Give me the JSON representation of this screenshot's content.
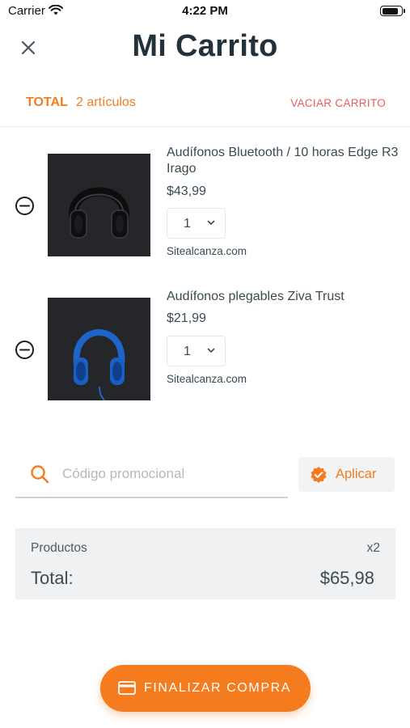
{
  "status_bar": {
    "carrier": "Carrier",
    "time": "4:22 PM",
    "battery_level": 0.9
  },
  "header": {
    "title": "Mi Carrito",
    "close_icon": "close-icon"
  },
  "summary": {
    "total_label": "TOTAL",
    "items_count": "2 artículos",
    "clear_label": "VACIAR CARRITO"
  },
  "items": [
    {
      "name": "Audífonos Bluetooth / 10 horas Edge R3 Irago",
      "price": "$43,99",
      "quantity": "1",
      "seller": "Sitealcanza.com",
      "image": "black-headphones"
    },
    {
      "name": "Audífonos plegables Ziva Trust",
      "price": "$21,99",
      "quantity": "1",
      "seller": "Sitealcanza.com",
      "image": "blue-headphones"
    }
  ],
  "promo": {
    "placeholder": "Código promocional",
    "value": "",
    "apply_label": "Aplicar"
  },
  "totals": {
    "products_label": "Productos",
    "products_count": "x2",
    "total_label": "Total:",
    "total_amount": "$65,98"
  },
  "checkout": {
    "label": "FINALIZAR COMPRA",
    "icon": "credit-card-icon"
  },
  "colors": {
    "accent": "#f47c1f",
    "danger": "#f05a5a",
    "text": "#33414a",
    "panel": "#eff1f3"
  }
}
